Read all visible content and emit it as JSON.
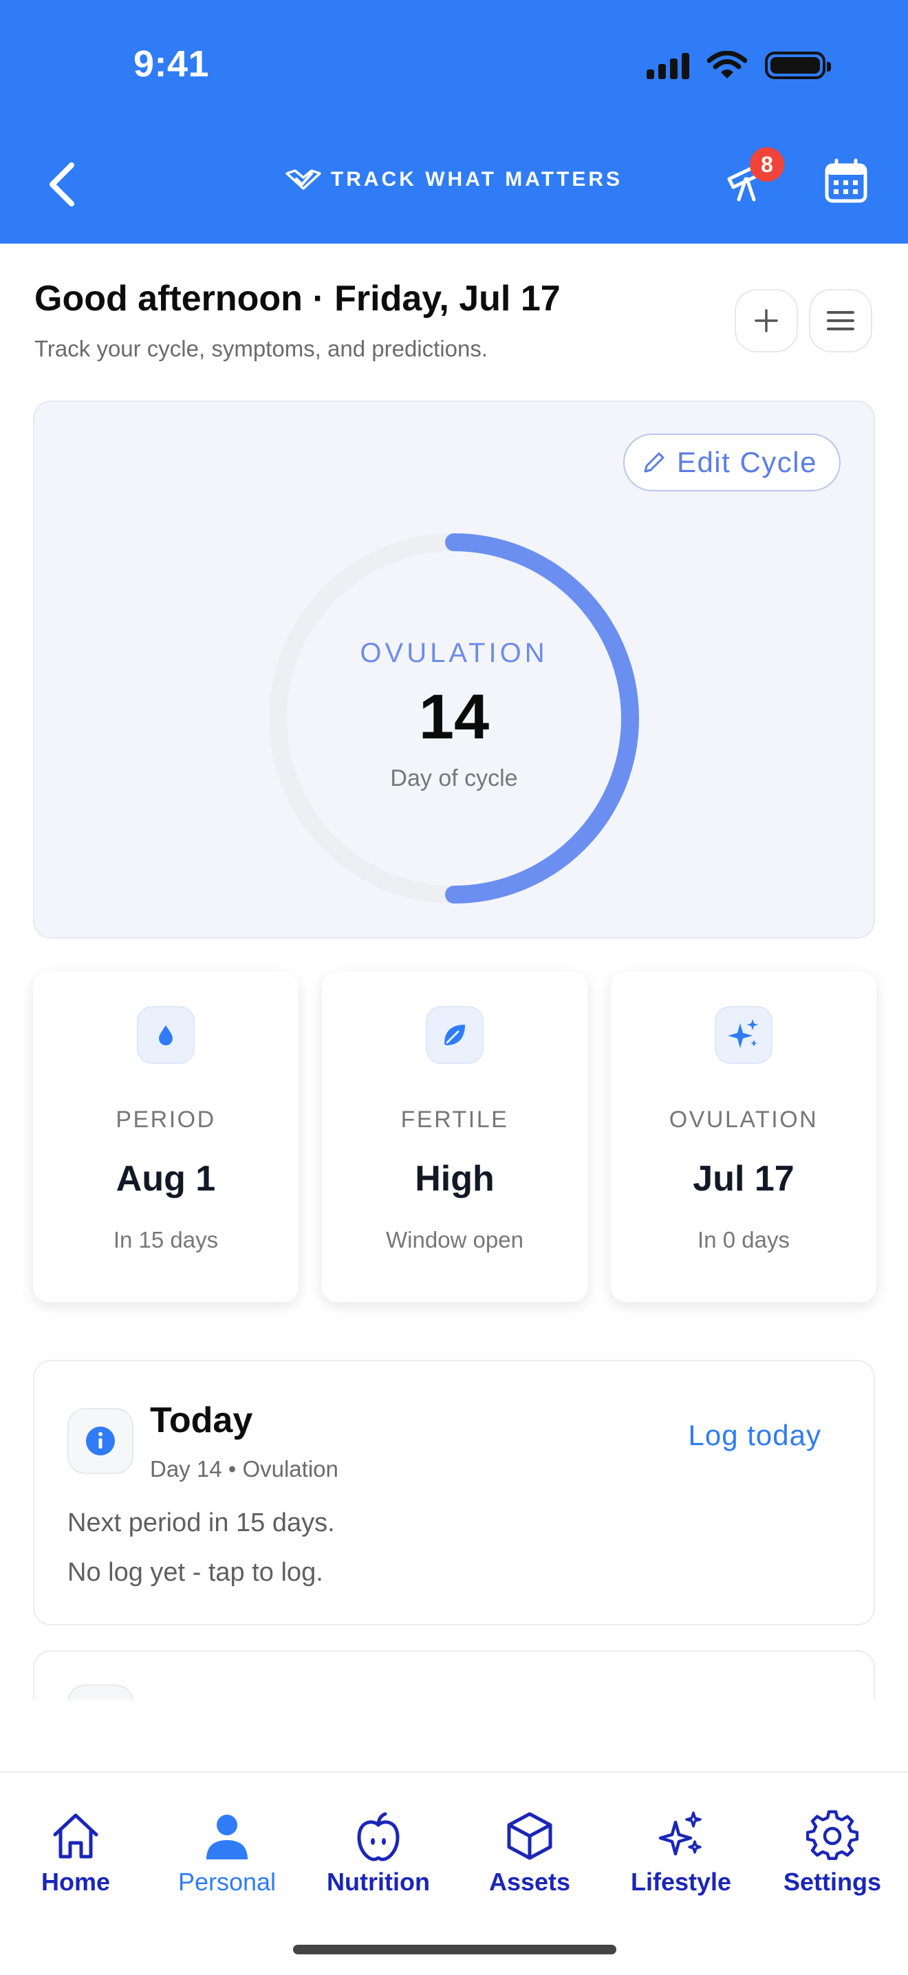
{
  "status_bar": {
    "time": "9:41"
  },
  "header": {
    "brand": "TRACK WHAT MATTERS",
    "notifications_count": "8",
    "accent_color": "#2f7cf6"
  },
  "greeting": {
    "title": "Good afternoon · Friday, Jul 17",
    "subtitle": "Track your cycle, symptoms, and predictions."
  },
  "cycle": {
    "edit_label": "Edit Cycle",
    "phase": "OVULATION",
    "day": "14",
    "day_label": "Day of cycle",
    "progress_fraction": 0.5
  },
  "stats": [
    {
      "label": "PERIOD",
      "value": "Aug 1",
      "sub": "In 15 days",
      "icon": "drop-icon"
    },
    {
      "label": "FERTILE",
      "value": "High",
      "sub": "Window open",
      "icon": "leaf-icon"
    },
    {
      "label": "OVULATION",
      "value": "Jul 17",
      "sub": "In 0 days",
      "icon": "sparkles-icon"
    }
  ],
  "today": {
    "title": "Today",
    "meta": "Day 14 • Ovulation",
    "action": "Log today",
    "line1": "Next period in 15 days.",
    "line2": "No log yet - tap to log."
  },
  "tabs": [
    {
      "label": "Home",
      "icon": "home-icon"
    },
    {
      "label": "Personal",
      "icon": "person-icon",
      "active": true
    },
    {
      "label": "Nutrition",
      "icon": "apple-icon"
    },
    {
      "label": "Assets",
      "icon": "cube-icon"
    },
    {
      "label": "Lifestyle",
      "icon": "sparkles-icon"
    },
    {
      "label": "Settings",
      "icon": "gear-icon"
    }
  ]
}
